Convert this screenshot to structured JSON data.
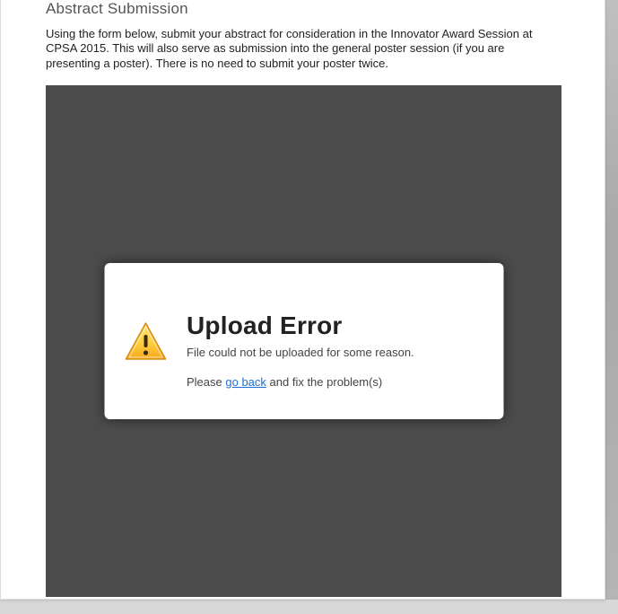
{
  "page": {
    "title": "Abstract Submission",
    "intro": "Using the form below, submit your abstract for consideration in the Innovator Award Session at CPSA 2015. This will also serve as submission into the general poster session (if you are presenting a poster). There is no need to submit your poster twice."
  },
  "error": {
    "title": "Upload Error",
    "message": "File could not be uploaded for some reason.",
    "action_prefix": "Please ",
    "action_link": "go back",
    "action_suffix": " and fix the problem(s)"
  }
}
